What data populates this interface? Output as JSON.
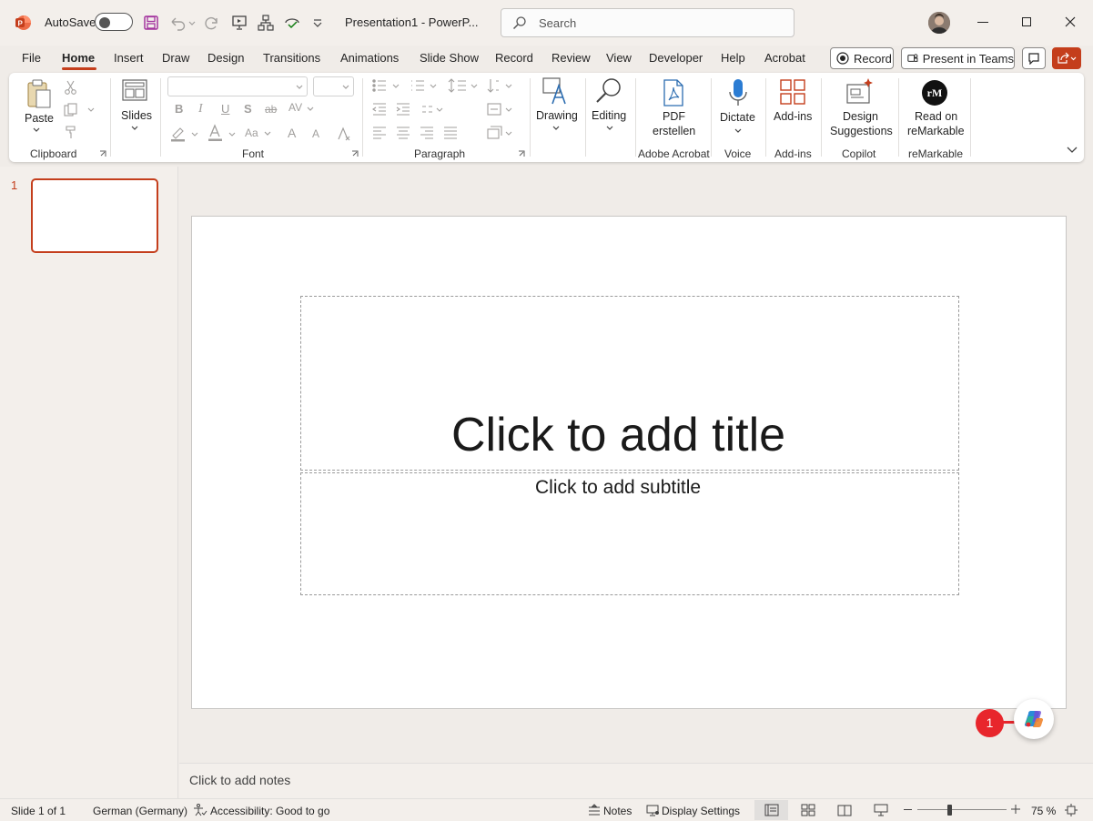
{
  "app": {
    "autosave_label": "AutoSave",
    "doc_title": "Presentation1  -  PowerP...",
    "colors": {
      "accent": "#c43e1c",
      "badge": "#e8262c"
    }
  },
  "search": {
    "placeholder": "Search"
  },
  "tabs": [
    "File",
    "Home",
    "Insert",
    "Draw",
    "Design",
    "Transitions",
    "Animations",
    "Slide Show",
    "Record",
    "Review",
    "View",
    "Developer",
    "Help",
    "Acrobat"
  ],
  "tab_actions": {
    "record": "Record",
    "present_teams": "Present in Teams"
  },
  "ribbon": {
    "clipboard": {
      "paste": "Paste",
      "label": "Clipboard"
    },
    "slides": {
      "label": "Slides"
    },
    "font": {
      "label": "Font",
      "bold": "B",
      "italic": "I",
      "underline": "U",
      "shadow": "S",
      "strike": "ab",
      "spacing": "AV",
      "case": "Aa",
      "grow": "A",
      "shrink": "A"
    },
    "paragraph": {
      "label": "Paragraph"
    },
    "drawing": {
      "label": "Drawing"
    },
    "editing": {
      "label": "Editing"
    },
    "pdf": {
      "line1": "PDF",
      "line2": "erstellen",
      "group": "Adobe Acrobat"
    },
    "voice": {
      "dictate": "Dictate",
      "group": "Voice"
    },
    "addins": {
      "button": "Add-ins",
      "group": "Add-ins"
    },
    "copilot": {
      "line1": "Design",
      "line2": "Suggestions",
      "group": "Copilot"
    },
    "remarkable": {
      "line1": "Read on",
      "line2": "reMarkable",
      "group": "reMarkable",
      "logo": "rM"
    }
  },
  "slides_pane": {
    "number": "1"
  },
  "slide": {
    "title_placeholder": "Click to add title",
    "subtitle_placeholder": "Click to add subtitle"
  },
  "notes": {
    "placeholder": "Click to add notes"
  },
  "status": {
    "slide_count": "Slide 1 of 1",
    "language": "German (Germany)",
    "accessibility": "Accessibility: Good to go",
    "notes": "Notes",
    "display_settings": "Display Settings",
    "zoom": "75 %"
  },
  "annotation": {
    "badge": "1"
  }
}
